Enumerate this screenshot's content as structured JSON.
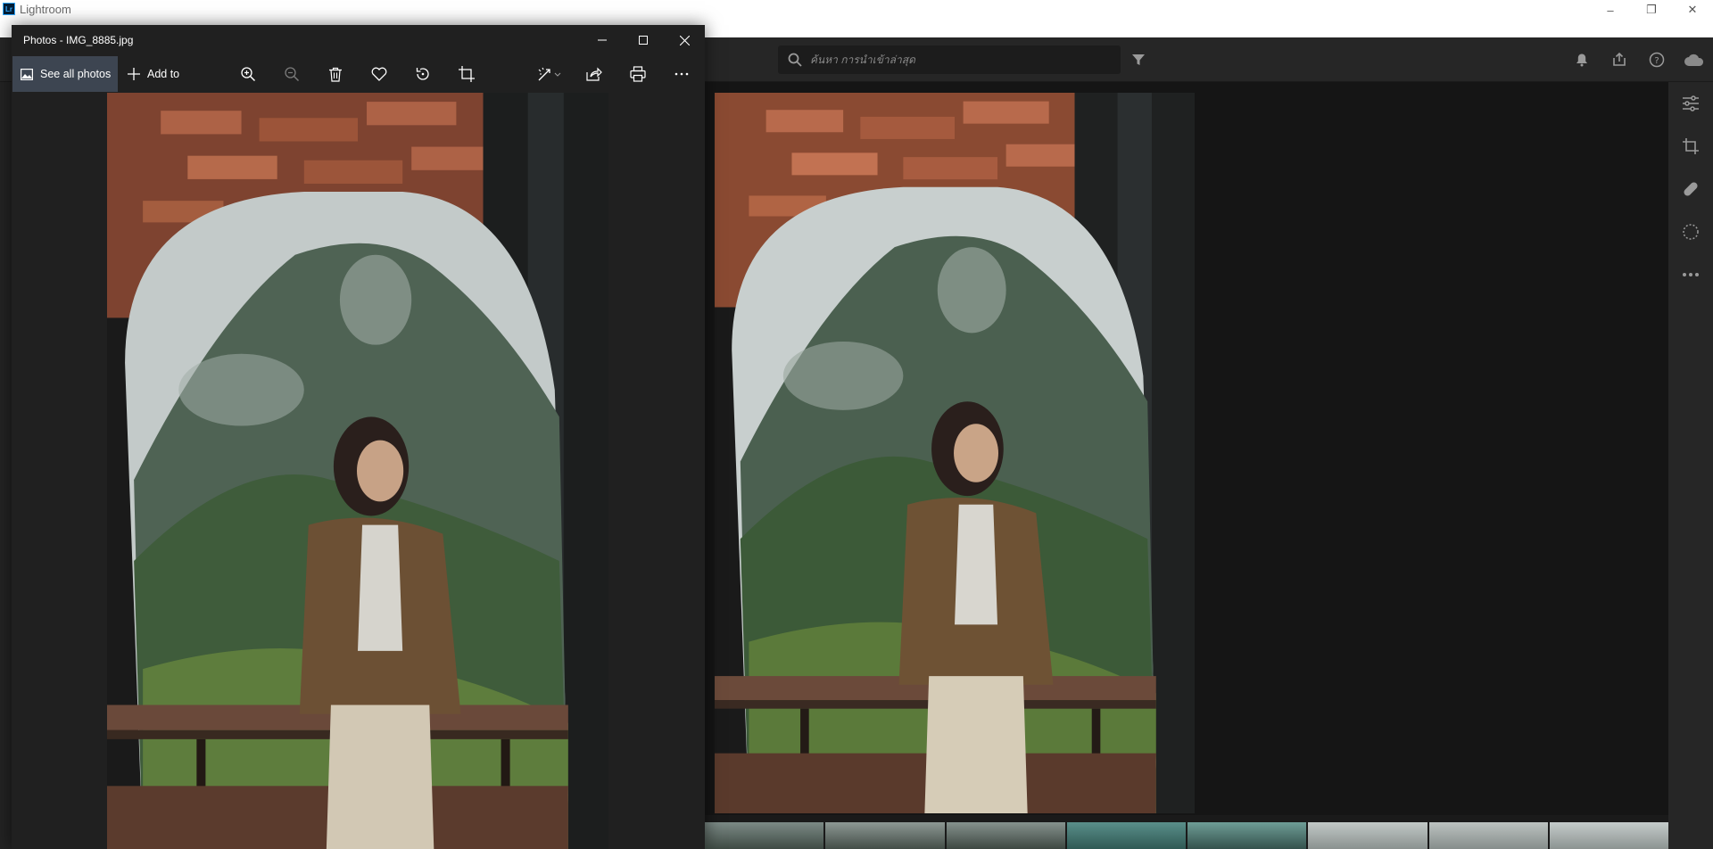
{
  "lightroom": {
    "title": "Lightroom",
    "logo": "Lr",
    "search": {
      "placeholder": "ค้นหา การนำเข้าล่าสุด"
    },
    "toolbar_icons": [
      "bell-icon",
      "share-icon",
      "help-icon",
      "cloud-icon"
    ],
    "edit_panel_icons": [
      "sliders-icon",
      "crop-icon",
      "healing-icon",
      "mask-icon",
      "more-icon"
    ],
    "filmstrip_count": 8
  },
  "photos_app": {
    "title": "Photos - IMG_8885.jpg",
    "toolbar": {
      "see_all_label": "See all photos",
      "add_to_label": "Add to",
      "tools": [
        "zoom-in-icon",
        "zoom-out-icon",
        "delete-icon",
        "favorite-icon",
        "rotate-icon",
        "crop-icon",
        "edit-icon",
        "share-icon",
        "print-icon",
        "more-icon"
      ]
    }
  },
  "colors": {
    "lightroom_bg": "#1a1a1a",
    "photos_bg": "#202020",
    "photos_selected": "#3d4551",
    "lightroom_accent": "#31a8ff"
  }
}
